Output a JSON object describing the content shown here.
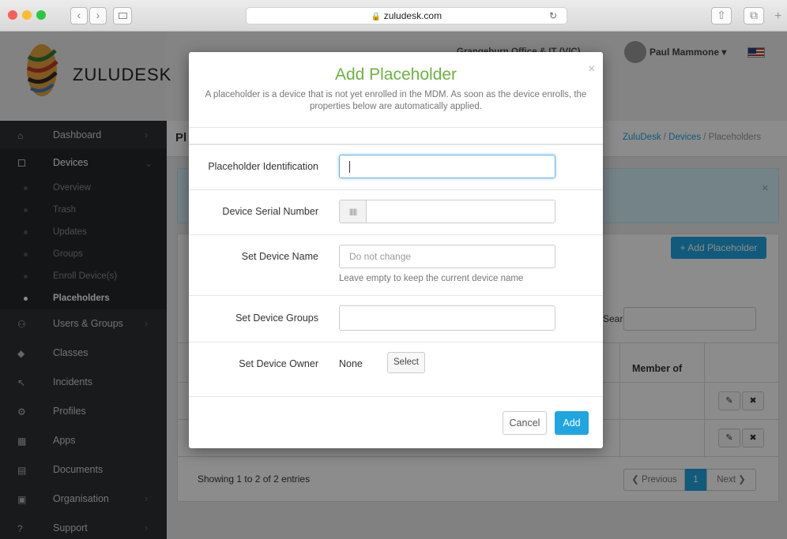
{
  "browser": {
    "url": "zuludesk.com",
    "lock_icon": "lock-icon",
    "reload_icon": "↻"
  },
  "header": {
    "logo_text": "ZULUDESK",
    "org": "Grangeburn Office & IT (VIC)",
    "user": "Paul Mammone ▾",
    "flag": "us-flag-icon"
  },
  "sidebar": {
    "items": [
      {
        "label": "Dashboard",
        "icon": "⌂"
      },
      {
        "label": "Devices",
        "icon": "☐"
      },
      {
        "label": "Users & Groups",
        "icon": "👥"
      },
      {
        "label": "Classes",
        "icon": "🎓"
      },
      {
        "label": "Incidents",
        "icon": "⚡"
      },
      {
        "label": "Profiles",
        "icon": "⚙"
      },
      {
        "label": "Apps",
        "icon": "▦"
      },
      {
        "label": "Documents",
        "icon": "▤"
      },
      {
        "label": "Organisation",
        "icon": "▣"
      },
      {
        "label": "Support",
        "icon": "?"
      }
    ],
    "subitems": [
      "Overview",
      "Trash",
      "Updates",
      "Groups",
      "Enroll Device(s)",
      "Placeholders"
    ]
  },
  "page": {
    "title": "Pl",
    "breadcrumb": [
      "ZuluDesk",
      "Devices",
      "Placeholders"
    ],
    "add_button": "+ Add Placeholder",
    "search_label": "Search:",
    "col_member_of": "Member of",
    "footer": "Showing 1 to 2 of 2 entries",
    "prev": "❮ Previous",
    "page_num": "1",
    "next": "Next ❯"
  },
  "modal": {
    "title": "Add Placeholder",
    "description": "A placeholder is a device that is not yet enrolled in the MDM. As soon as the device enrolls, the properties below are automatically applied.",
    "close": "×",
    "fields": {
      "identification_label": "Placeholder Identification",
      "serial_label": "Device Serial Number",
      "name_label": "Set Device Name",
      "name_placeholder": "Do not change",
      "name_help": "Leave empty to keep the current device name",
      "groups_label": "Set Device Groups",
      "owner_label": "Set Device Owner",
      "owner_value": "None",
      "select_button": "Select"
    },
    "cancel": "Cancel",
    "add": "Add"
  },
  "colors": {
    "accent": "#1fa5e0",
    "sidebar": "#2f3032",
    "title": "#6cb33f"
  }
}
